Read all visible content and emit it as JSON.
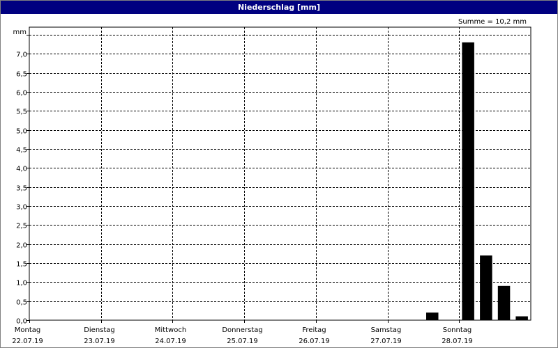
{
  "window": {
    "title": "Niederschlag [mm]"
  },
  "chart_data": {
    "type": "bar",
    "title": "Niederschlag [mm]",
    "ylabel": "mm",
    "sum_label": "Summe = 10,2 mm",
    "ylim": [
      0,
      7.7
    ],
    "y_ticks": [
      {
        "value": 0.0,
        "label": "0,0"
      },
      {
        "value": 0.5,
        "label": "0,5"
      },
      {
        "value": 1.0,
        "label": "1,0"
      },
      {
        "value": 1.5,
        "label": "1,5"
      },
      {
        "value": 2.0,
        "label": "2,0"
      },
      {
        "value": 2.5,
        "label": "2,5"
      },
      {
        "value": 3.0,
        "label": "3,0"
      },
      {
        "value": 3.5,
        "label": "3,5"
      },
      {
        "value": 4.0,
        "label": "4,0"
      },
      {
        "value": 4.5,
        "label": "4,5"
      },
      {
        "value": 5.0,
        "label": "5,0"
      },
      {
        "value": 5.5,
        "label": "5,5"
      },
      {
        "value": 6.0,
        "label": "6,0"
      },
      {
        "value": 6.5,
        "label": "6,5"
      },
      {
        "value": 7.0,
        "label": "7,0"
      },
      {
        "value": 7.5,
        "label": ""
      }
    ],
    "days": [
      {
        "weekday": "Montag",
        "date": "22.07.19"
      },
      {
        "weekday": "Dienstag",
        "date": "23.07.19"
      },
      {
        "weekday": "Mittwoch",
        "date": "24.07.19"
      },
      {
        "weekday": "Donnerstag",
        "date": "25.07.19"
      },
      {
        "weekday": "Freitag",
        "date": "26.07.19"
      },
      {
        "weekday": "Samstag",
        "date": "27.07.19"
      },
      {
        "weekday": "Sonntag",
        "date": "28.07.19"
      }
    ],
    "interval_hours": 6,
    "values": [
      0,
      0,
      0,
      0,
      0,
      0,
      0,
      0,
      0,
      0,
      0,
      0,
      0,
      0,
      0,
      0,
      0,
      0,
      0,
      0,
      0,
      0,
      0.2,
      0,
      7.3,
      1.7,
      0.9,
      0.1
    ],
    "grid": true,
    "bar_color": "#000000"
  }
}
